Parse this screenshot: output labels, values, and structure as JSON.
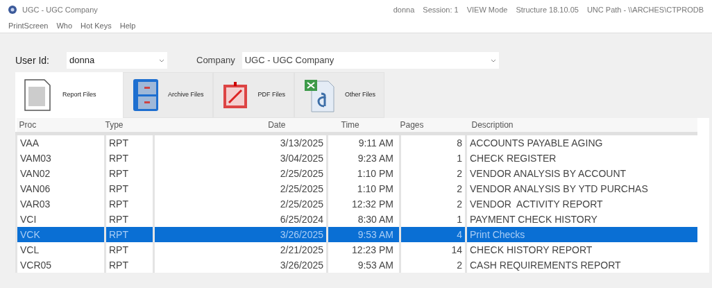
{
  "window": {
    "title": "UGC - UGC Company",
    "status": [
      "donna",
      "Session: 1",
      "VIEW Mode",
      "Structure 18.10.05",
      "UNC Path - \\\\ARCHES\\CTPRODB"
    ]
  },
  "menu": [
    "PrintScreen",
    "Who",
    "Hot Keys",
    "Help"
  ],
  "user_id": {
    "label": "User Id:",
    "value": "donna"
  },
  "company": {
    "label": "Company",
    "value": "UGC - UGC Company"
  },
  "tabs": [
    {
      "label": "Report Files",
      "kind": "report",
      "selected": true
    },
    {
      "label": "Archive Files",
      "kind": "archive",
      "selected": false
    },
    {
      "label": "PDF Files",
      "kind": "pdf",
      "selected": false
    },
    {
      "label": "Other Files",
      "kind": "other",
      "selected": false
    }
  ],
  "table": {
    "columns": [
      "Proc",
      "Type",
      "Date",
      "Time",
      "Pages",
      "Description"
    ],
    "rows": [
      {
        "proc": "VAA",
        "type": "RPT",
        "date": "3/13/2025",
        "time": "9:11 AM",
        "pages": "8",
        "description": "ACCOUNTS PAYABLE AGING",
        "selected": false
      },
      {
        "proc": "VAM03",
        "type": "RPT",
        "date": "3/04/2025",
        "time": "9:23 AM",
        "pages": "1",
        "description": "CHECK REGISTER",
        "selected": false
      },
      {
        "proc": "VAN02",
        "type": "RPT",
        "date": "2/25/2025",
        "time": "1:10 PM",
        "pages": "2",
        "description": "VENDOR ANALYSIS BY ACCOUNT",
        "selected": false
      },
      {
        "proc": "VAN06",
        "type": "RPT",
        "date": "2/25/2025",
        "time": "1:10 PM",
        "pages": "2",
        "description": "VENDOR ANALYSIS BY YTD PURCHAS",
        "selected": false
      },
      {
        "proc": "VAR03",
        "type": "RPT",
        "date": "2/25/2025",
        "time": "12:32 PM",
        "pages": "2",
        "description": "VENDOR  ACTIVITY REPORT",
        "selected": false
      },
      {
        "proc": "VCI",
        "type": "RPT",
        "date": "6/25/2024",
        "time": "8:30 AM",
        "pages": "1",
        "description": "PAYMENT CHECK HISTORY",
        "selected": false
      },
      {
        "proc": "VCK",
        "type": "RPT",
        "date": "3/26/2025",
        "time": "9:53 AM",
        "pages": "4",
        "description": "Print Checks",
        "selected": true
      },
      {
        "proc": "VCL",
        "type": "RPT",
        "date": "2/21/2025",
        "time": "12:23 PM",
        "pages": "14",
        "description": "CHECK HISTORY REPORT",
        "selected": false
      },
      {
        "proc": "VCR05",
        "type": "RPT",
        "date": "3/26/2025",
        "time": "9:53 AM",
        "pages": "2",
        "description": "CASH REQUIREMENTS REPORT",
        "selected": false
      }
    ]
  }
}
